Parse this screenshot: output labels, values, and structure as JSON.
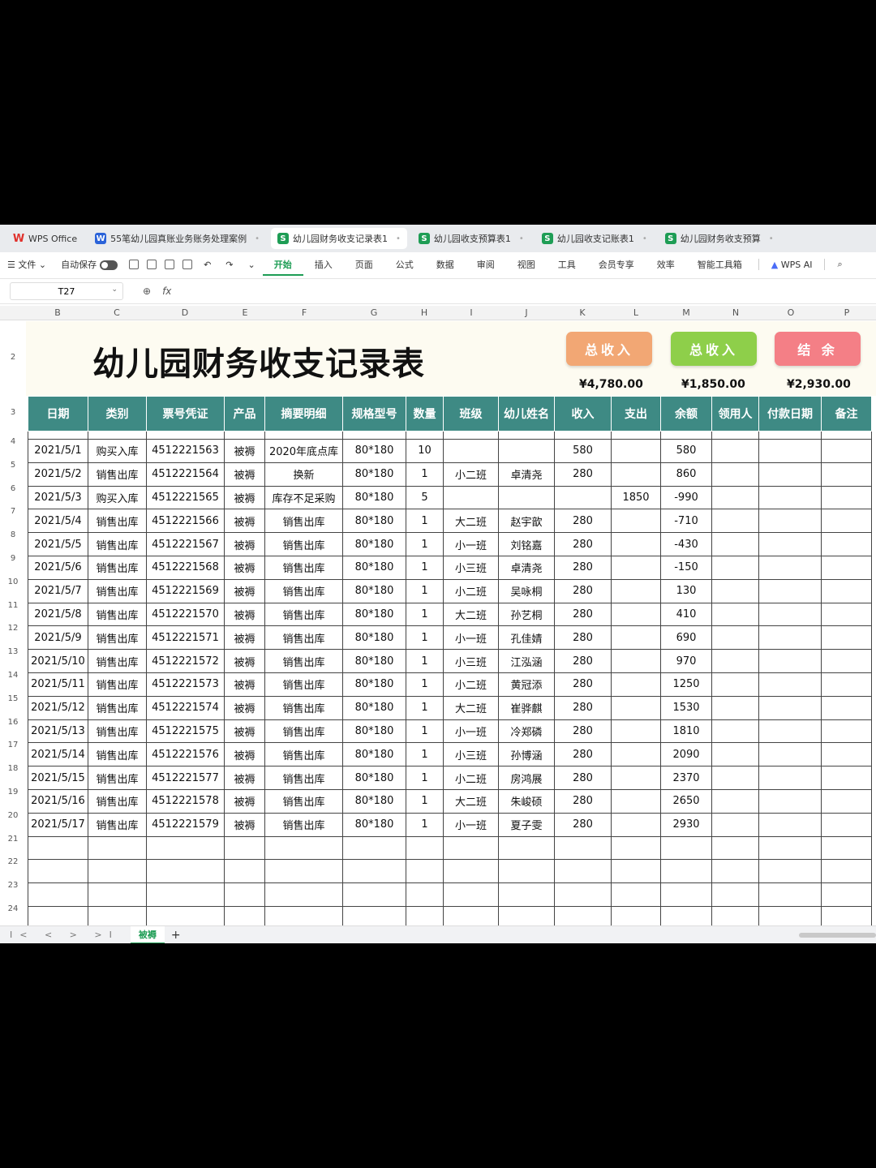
{
  "tabs": [
    {
      "icon": "wps-icon",
      "label": "WPS Office",
      "active": false
    },
    {
      "icon": "word-icon",
      "label": "55笔幼儿园真账业务账务处理案例",
      "active": false
    },
    {
      "icon": "sheet-icon",
      "label": "幼儿园财务收支记录表1",
      "active": true
    },
    {
      "icon": "sheet-icon",
      "label": "幼儿园收支预算表1",
      "active": false
    },
    {
      "icon": "sheet-icon",
      "label": "幼儿园收支记账表1",
      "active": false
    },
    {
      "icon": "sheet-icon",
      "label": "幼儿园财务收支预算",
      "active": false
    }
  ],
  "ribbon": {
    "file": "文件",
    "autosave": "自动保存",
    "menu": [
      "开始",
      "插入",
      "页面",
      "公式",
      "数据",
      "审阅",
      "视图",
      "工具",
      "会员专享",
      "效率",
      "智能工具箱"
    ],
    "ai": "WPS AI"
  },
  "formula_bar": {
    "cell_ref": "T27",
    "fx": "fx"
  },
  "columns": [
    "B",
    "C",
    "D",
    "E",
    "F",
    "G",
    "H",
    "I",
    "J",
    "K",
    "L",
    "M",
    "N",
    "O",
    "P"
  ],
  "sheet_title": "幼儿园财务收支记录表",
  "summary": [
    {
      "label": "总收入",
      "value": "¥4,780.00",
      "color": "#f2a774"
    },
    {
      "label": "总收入",
      "value": "¥1,850.00",
      "color": "#8ecf4a"
    },
    {
      "label": "结 余",
      "value": "¥2,930.00",
      "color": "#f47f86"
    }
  ],
  "headers": [
    "日期",
    "类别",
    "票号凭证",
    "产品",
    "摘要明细",
    "规格型号",
    "数量",
    "班级",
    "幼儿姓名",
    "收入",
    "支出",
    "余额",
    "领用人",
    "付款日期",
    "备注"
  ],
  "rows": [
    [
      "2021/5/1",
      "购买入库",
      "4512221563",
      "被褥",
      "2020年底点库",
      "80*180",
      "10",
      "",
      "",
      "580",
      "",
      "580",
      "",
      "",
      ""
    ],
    [
      "2021/5/2",
      "销售出库",
      "4512221564",
      "被褥",
      "换新",
      "80*180",
      "1",
      "小二班",
      "卓清尧",
      "280",
      "",
      "860",
      "",
      "",
      ""
    ],
    [
      "2021/5/3",
      "购买入库",
      "4512221565",
      "被褥",
      "库存不足采购",
      "80*180",
      "5",
      "",
      "",
      "",
      "1850",
      "-990",
      "",
      "",
      ""
    ],
    [
      "2021/5/4",
      "销售出库",
      "4512221566",
      "被褥",
      "销售出库",
      "80*180",
      "1",
      "大二班",
      "赵宇歆",
      "280",
      "",
      "-710",
      "",
      "",
      ""
    ],
    [
      "2021/5/5",
      "销售出库",
      "4512221567",
      "被褥",
      "销售出库",
      "80*180",
      "1",
      "小一班",
      "刘铭嘉",
      "280",
      "",
      "-430",
      "",
      "",
      ""
    ],
    [
      "2021/5/6",
      "销售出库",
      "4512221568",
      "被褥",
      "销售出库",
      "80*180",
      "1",
      "小三班",
      "卓清尧",
      "280",
      "",
      "-150",
      "",
      "",
      ""
    ],
    [
      "2021/5/7",
      "销售出库",
      "4512221569",
      "被褥",
      "销售出库",
      "80*180",
      "1",
      "小二班",
      "吴咏桐",
      "280",
      "",
      "130",
      "",
      "",
      ""
    ],
    [
      "2021/5/8",
      "销售出库",
      "4512221570",
      "被褥",
      "销售出库",
      "80*180",
      "1",
      "大二班",
      "孙艺桐",
      "280",
      "",
      "410",
      "",
      "",
      ""
    ],
    [
      "2021/5/9",
      "销售出库",
      "4512221571",
      "被褥",
      "销售出库",
      "80*180",
      "1",
      "小一班",
      "孔佳婧",
      "280",
      "",
      "690",
      "",
      "",
      ""
    ],
    [
      "2021/5/10",
      "销售出库",
      "4512221572",
      "被褥",
      "销售出库",
      "80*180",
      "1",
      "小三班",
      "江泓涵",
      "280",
      "",
      "970",
      "",
      "",
      ""
    ],
    [
      "2021/5/11",
      "销售出库",
      "4512221573",
      "被褥",
      "销售出库",
      "80*180",
      "1",
      "小二班",
      "黄冠添",
      "280",
      "",
      "1250",
      "",
      "",
      ""
    ],
    [
      "2021/5/12",
      "销售出库",
      "4512221574",
      "被褥",
      "销售出库",
      "80*180",
      "1",
      "大二班",
      "崔骅麒",
      "280",
      "",
      "1530",
      "",
      "",
      ""
    ],
    [
      "2021/5/13",
      "销售出库",
      "4512221575",
      "被褥",
      "销售出库",
      "80*180",
      "1",
      "小一班",
      "冷郑磷",
      "280",
      "",
      "1810",
      "",
      "",
      ""
    ],
    [
      "2021/5/14",
      "销售出库",
      "4512221576",
      "被褥",
      "销售出库",
      "80*180",
      "1",
      "小三班",
      "孙博涵",
      "280",
      "",
      "2090",
      "",
      "",
      ""
    ],
    [
      "2021/5/15",
      "销售出库",
      "4512221577",
      "被褥",
      "销售出库",
      "80*180",
      "1",
      "小二班",
      "房鸿展",
      "280",
      "",
      "2370",
      "",
      "",
      ""
    ],
    [
      "2021/5/16",
      "销售出库",
      "4512221578",
      "被褥",
      "销售出库",
      "80*180",
      "1",
      "大二班",
      "朱峻硕",
      "280",
      "",
      "2650",
      "",
      "",
      ""
    ],
    [
      "2021/5/17",
      "销售出库",
      "4512221579",
      "被褥",
      "销售出库",
      "80*180",
      "1",
      "小一班",
      "夏子雯",
      "280",
      "",
      "2930",
      "",
      "",
      ""
    ],
    [
      "",
      "",
      "",
      "",
      "",
      "",
      "",
      "",
      "",
      "",
      "",
      "",
      "",
      "",
      ""
    ],
    [
      "",
      "",
      "",
      "",
      "",
      "",
      "",
      "",
      "",
      "",
      "",
      "",
      "",
      "",
      ""
    ],
    [
      "",
      "",
      "",
      "",
      "",
      "",
      "",
      "",
      "",
      "",
      "",
      "",
      "",
      "",
      ""
    ],
    [
      "",
      "",
      "",
      "",
      "",
      "",
      "",
      "",
      "",
      "",
      "",
      "",
      "",
      "",
      ""
    ]
  ],
  "row_numbers": [
    "2",
    "3",
    "4",
    "5",
    "6",
    "7",
    "8",
    "9",
    "10",
    "11",
    "12",
    "13",
    "14",
    "15",
    "16",
    "17",
    "18",
    "19",
    "20",
    "21",
    "22",
    "23",
    "24"
  ],
  "sheet_tab": "被褥",
  "add_sheet": "+",
  "nav_arrows": "I< < > >I"
}
